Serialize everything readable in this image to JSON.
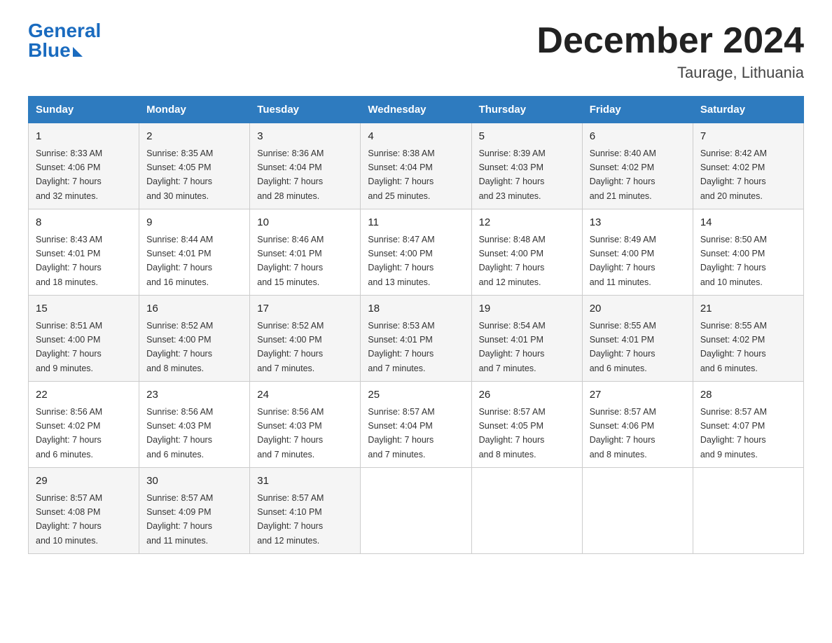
{
  "logo": {
    "general": "General",
    "blue": "Blue"
  },
  "title": "December 2024",
  "location": "Taurage, Lithuania",
  "days_of_week": [
    "Sunday",
    "Monday",
    "Tuesday",
    "Wednesday",
    "Thursday",
    "Friday",
    "Saturday"
  ],
  "weeks": [
    [
      {
        "day": "1",
        "sunrise": "8:33 AM",
        "sunset": "4:06 PM",
        "daylight": "7 hours and 32 minutes."
      },
      {
        "day": "2",
        "sunrise": "8:35 AM",
        "sunset": "4:05 PM",
        "daylight": "7 hours and 30 minutes."
      },
      {
        "day": "3",
        "sunrise": "8:36 AM",
        "sunset": "4:04 PM",
        "daylight": "7 hours and 28 minutes."
      },
      {
        "day": "4",
        "sunrise": "8:38 AM",
        "sunset": "4:04 PM",
        "daylight": "7 hours and 25 minutes."
      },
      {
        "day": "5",
        "sunrise": "8:39 AM",
        "sunset": "4:03 PM",
        "daylight": "7 hours and 23 minutes."
      },
      {
        "day": "6",
        "sunrise": "8:40 AM",
        "sunset": "4:02 PM",
        "daylight": "7 hours and 21 minutes."
      },
      {
        "day": "7",
        "sunrise": "8:42 AM",
        "sunset": "4:02 PM",
        "daylight": "7 hours and 20 minutes."
      }
    ],
    [
      {
        "day": "8",
        "sunrise": "8:43 AM",
        "sunset": "4:01 PM",
        "daylight": "7 hours and 18 minutes."
      },
      {
        "day": "9",
        "sunrise": "8:44 AM",
        "sunset": "4:01 PM",
        "daylight": "7 hours and 16 minutes."
      },
      {
        "day": "10",
        "sunrise": "8:46 AM",
        "sunset": "4:01 PM",
        "daylight": "7 hours and 15 minutes."
      },
      {
        "day": "11",
        "sunrise": "8:47 AM",
        "sunset": "4:00 PM",
        "daylight": "7 hours and 13 minutes."
      },
      {
        "day": "12",
        "sunrise": "8:48 AM",
        "sunset": "4:00 PM",
        "daylight": "7 hours and 12 minutes."
      },
      {
        "day": "13",
        "sunrise": "8:49 AM",
        "sunset": "4:00 PM",
        "daylight": "7 hours and 11 minutes."
      },
      {
        "day": "14",
        "sunrise": "8:50 AM",
        "sunset": "4:00 PM",
        "daylight": "7 hours and 10 minutes."
      }
    ],
    [
      {
        "day": "15",
        "sunrise": "8:51 AM",
        "sunset": "4:00 PM",
        "daylight": "7 hours and 9 minutes."
      },
      {
        "day": "16",
        "sunrise": "8:52 AM",
        "sunset": "4:00 PM",
        "daylight": "7 hours and 8 minutes."
      },
      {
        "day": "17",
        "sunrise": "8:52 AM",
        "sunset": "4:00 PM",
        "daylight": "7 hours and 7 minutes."
      },
      {
        "day": "18",
        "sunrise": "8:53 AM",
        "sunset": "4:01 PM",
        "daylight": "7 hours and 7 minutes."
      },
      {
        "day": "19",
        "sunrise": "8:54 AM",
        "sunset": "4:01 PM",
        "daylight": "7 hours and 7 minutes."
      },
      {
        "day": "20",
        "sunrise": "8:55 AM",
        "sunset": "4:01 PM",
        "daylight": "7 hours and 6 minutes."
      },
      {
        "day": "21",
        "sunrise": "8:55 AM",
        "sunset": "4:02 PM",
        "daylight": "7 hours and 6 minutes."
      }
    ],
    [
      {
        "day": "22",
        "sunrise": "8:56 AM",
        "sunset": "4:02 PM",
        "daylight": "7 hours and 6 minutes."
      },
      {
        "day": "23",
        "sunrise": "8:56 AM",
        "sunset": "4:03 PM",
        "daylight": "7 hours and 6 minutes."
      },
      {
        "day": "24",
        "sunrise": "8:56 AM",
        "sunset": "4:03 PM",
        "daylight": "7 hours and 7 minutes."
      },
      {
        "day": "25",
        "sunrise": "8:57 AM",
        "sunset": "4:04 PM",
        "daylight": "7 hours and 7 minutes."
      },
      {
        "day": "26",
        "sunrise": "8:57 AM",
        "sunset": "4:05 PM",
        "daylight": "7 hours and 8 minutes."
      },
      {
        "day": "27",
        "sunrise": "8:57 AM",
        "sunset": "4:06 PM",
        "daylight": "7 hours and 8 minutes."
      },
      {
        "day": "28",
        "sunrise": "8:57 AM",
        "sunset": "4:07 PM",
        "daylight": "7 hours and 9 minutes."
      }
    ],
    [
      {
        "day": "29",
        "sunrise": "8:57 AM",
        "sunset": "4:08 PM",
        "daylight": "7 hours and 10 minutes."
      },
      {
        "day": "30",
        "sunrise": "8:57 AM",
        "sunset": "4:09 PM",
        "daylight": "7 hours and 11 minutes."
      },
      {
        "day": "31",
        "sunrise": "8:57 AM",
        "sunset": "4:10 PM",
        "daylight": "7 hours and 12 minutes."
      },
      null,
      null,
      null,
      null
    ]
  ],
  "labels": {
    "sunrise": "Sunrise:",
    "sunset": "Sunset:",
    "daylight": "Daylight:"
  }
}
